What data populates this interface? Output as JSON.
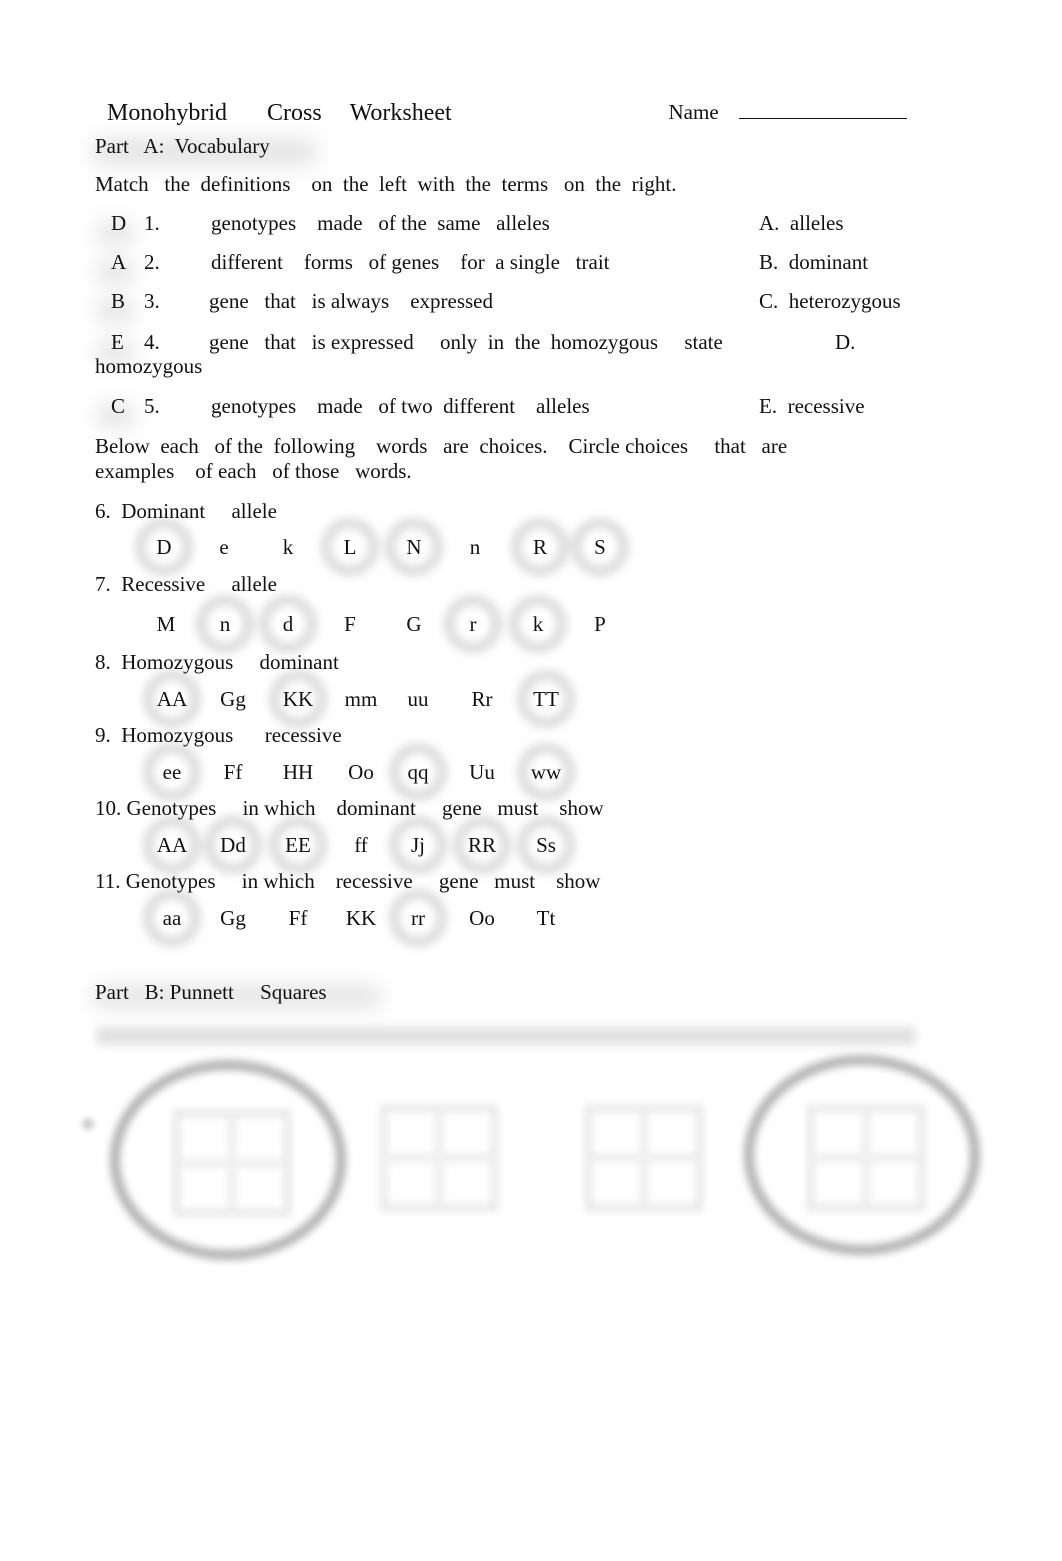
{
  "header": {
    "title_words": [
      "Monohybrid",
      "Cross",
      "Worksheet"
    ],
    "name_label": "Name"
  },
  "part_a": {
    "heading": "Part   A:  Vocabulary",
    "instructions": "Match   the  definitions    on  the  left  with  the  terms   on  the  right.",
    "items": [
      {
        "answer": "D",
        "number": "1.",
        "definition": "genotypes    made   of the  same   alleles",
        "term": "A.  alleles"
      },
      {
        "answer": "A",
        "number": "2.",
        "definition": "different    forms   of genes    for  a single   trait",
        "term": "B.  dominant"
      },
      {
        "answer": "B",
        "number": "3.",
        "definition": "gene   that   is always    expressed",
        "term": "C.  heterozygous"
      },
      {
        "answer": "E",
        "number": "4.",
        "definition": "gene   that   is expressed     only  in  the  homozygous     state",
        "term": "D.",
        "term_wrap": "homozygous"
      },
      {
        "answer": "C",
        "number": "5.",
        "definition": "genotypes    made   of two  different    alleles",
        "term": "E.  recessive"
      }
    ],
    "circle_instructions_line1": "Below  each   of the  following    words   are  choices.    Circle choices     that   are",
    "circle_instructions_line2": "examples    of each   of those   words.",
    "questions": [
      {
        "label": "6.  Dominant     allele",
        "choices": [
          {
            "text": "D",
            "circled": true
          },
          {
            "text": "e",
            "circled": false
          },
          {
            "text": "k",
            "circled": false
          },
          {
            "text": "L",
            "circled": true
          },
          {
            "text": "N",
            "circled": true
          },
          {
            "text": "n",
            "circled": false
          },
          {
            "text": "R",
            "circled": true
          },
          {
            "text": "S",
            "circled": true
          }
        ]
      },
      {
        "label": "7.  Recessive     allele",
        "choices": [
          {
            "text": "M",
            "circled": false
          },
          {
            "text": "n",
            "circled": true
          },
          {
            "text": "d",
            "circled": true
          },
          {
            "text": "F",
            "circled": false
          },
          {
            "text": "G",
            "circled": false
          },
          {
            "text": "r",
            "circled": true
          },
          {
            "text": "k",
            "circled": true
          },
          {
            "text": "P",
            "circled": false
          }
        ]
      },
      {
        "label": "8.  Homozygous     dominant",
        "choices": [
          {
            "text": "AA",
            "circled": true
          },
          {
            "text": "Gg",
            "circled": false
          },
          {
            "text": "KK",
            "circled": true
          },
          {
            "text": "mm",
            "circled": false
          },
          {
            "text": "uu",
            "circled": false
          },
          {
            "text": "Rr",
            "circled": false
          },
          {
            "text": "TT",
            "circled": true
          }
        ]
      },
      {
        "label": "9.  Homozygous      recessive",
        "choices": [
          {
            "text": "ee",
            "circled": true
          },
          {
            "text": "Ff",
            "circled": false
          },
          {
            "text": "HH",
            "circled": false
          },
          {
            "text": "Oo",
            "circled": false
          },
          {
            "text": "qq",
            "circled": true
          },
          {
            "text": "Uu",
            "circled": false
          },
          {
            "text": "ww",
            "circled": true
          }
        ]
      },
      {
        "label": "10. Genotypes     in which    dominant     gene   must    show",
        "choices": [
          {
            "text": "AA",
            "circled": true
          },
          {
            "text": "Dd",
            "circled": true
          },
          {
            "text": "EE",
            "circled": true
          },
          {
            "text": "ff",
            "circled": false
          },
          {
            "text": "Jj",
            "circled": true
          },
          {
            "text": "RR",
            "circled": true
          },
          {
            "text": "Ss",
            "circled": true
          }
        ]
      },
      {
        "label": "11. Genotypes     in which    recessive     gene   must    show",
        "choices": [
          {
            "text": "aa",
            "circled": true
          },
          {
            "text": "Gg",
            "circled": false
          },
          {
            "text": "Ff",
            "circled": false
          },
          {
            "text": "KK",
            "circled": false
          },
          {
            "text": "rr",
            "circled": true
          },
          {
            "text": "Oo",
            "circled": false
          },
          {
            "text": "Tt",
            "circled": false
          }
        ]
      }
    ]
  },
  "part_b": {
    "heading": "Part   B: Punnett     Squares",
    "punnett_squares": [
      {
        "circled": true
      },
      {
        "circled": false
      },
      {
        "circled": false
      },
      {
        "circled": true
      }
    ]
  }
}
